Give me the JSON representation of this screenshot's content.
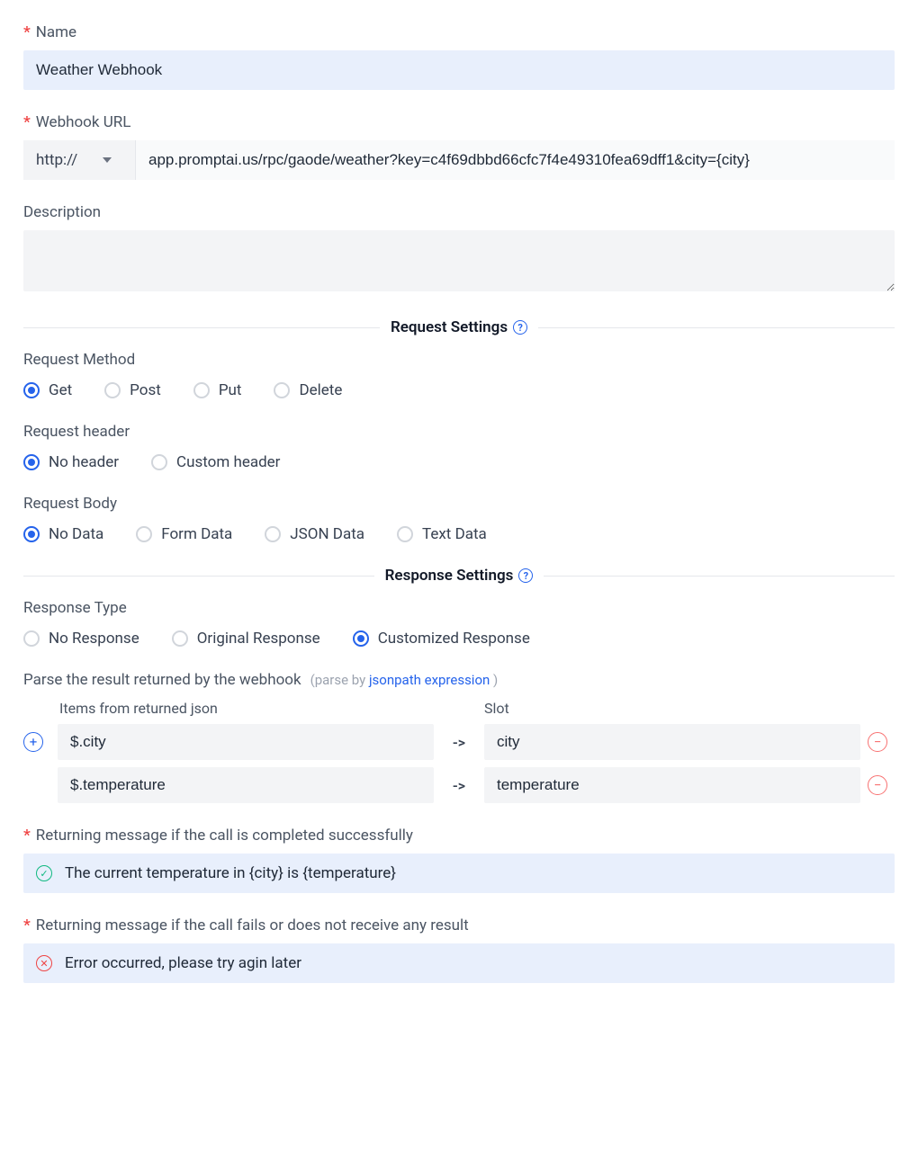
{
  "name": {
    "label": "Name",
    "value": "Weather Webhook"
  },
  "webhook_url": {
    "label": "Webhook URL",
    "protocol": "http://",
    "value": "app.promptai.us/rpc/gaode/weather?key=c4f69dbbd66cfc7f4e49310fea69dff1&city={city}"
  },
  "description": {
    "label": "Description",
    "value": ""
  },
  "request_settings": {
    "title": "Request Settings",
    "method": {
      "label": "Request Method",
      "options": [
        "Get",
        "Post",
        "Put",
        "Delete"
      ],
      "selected": "Get"
    },
    "header": {
      "label": "Request header",
      "options": [
        "No header",
        "Custom header"
      ],
      "selected": "No header"
    },
    "body": {
      "label": "Request Body",
      "options": [
        "No Data",
        "Form Data",
        "JSON Data",
        "Text Data"
      ],
      "selected": "No Data"
    }
  },
  "response_settings": {
    "title": "Response Settings",
    "type": {
      "label": "Response Type",
      "options": [
        "No Response",
        "Original Response",
        "Customized Response"
      ],
      "selected": "Customized Response"
    },
    "parse": {
      "title": "Parse the result returned by the webhook",
      "sub_prefix": "(parse by ",
      "link_text": "jsonpath expression",
      "sub_suffix": " )",
      "col_items": "Items from returned json",
      "col_slot": "Slot",
      "arrow": "->",
      "rows": [
        {
          "item": "$.city",
          "slot": "city"
        },
        {
          "item": "$.temperature",
          "slot": "temperature"
        }
      ]
    },
    "success_msg": {
      "label": "Returning message if the call is completed successfully",
      "value": "The current temperature in {city} is {temperature}"
    },
    "error_msg": {
      "label": "Returning message if the call fails or does not receive any result",
      "value": "Error occurred, please try agin later"
    }
  }
}
